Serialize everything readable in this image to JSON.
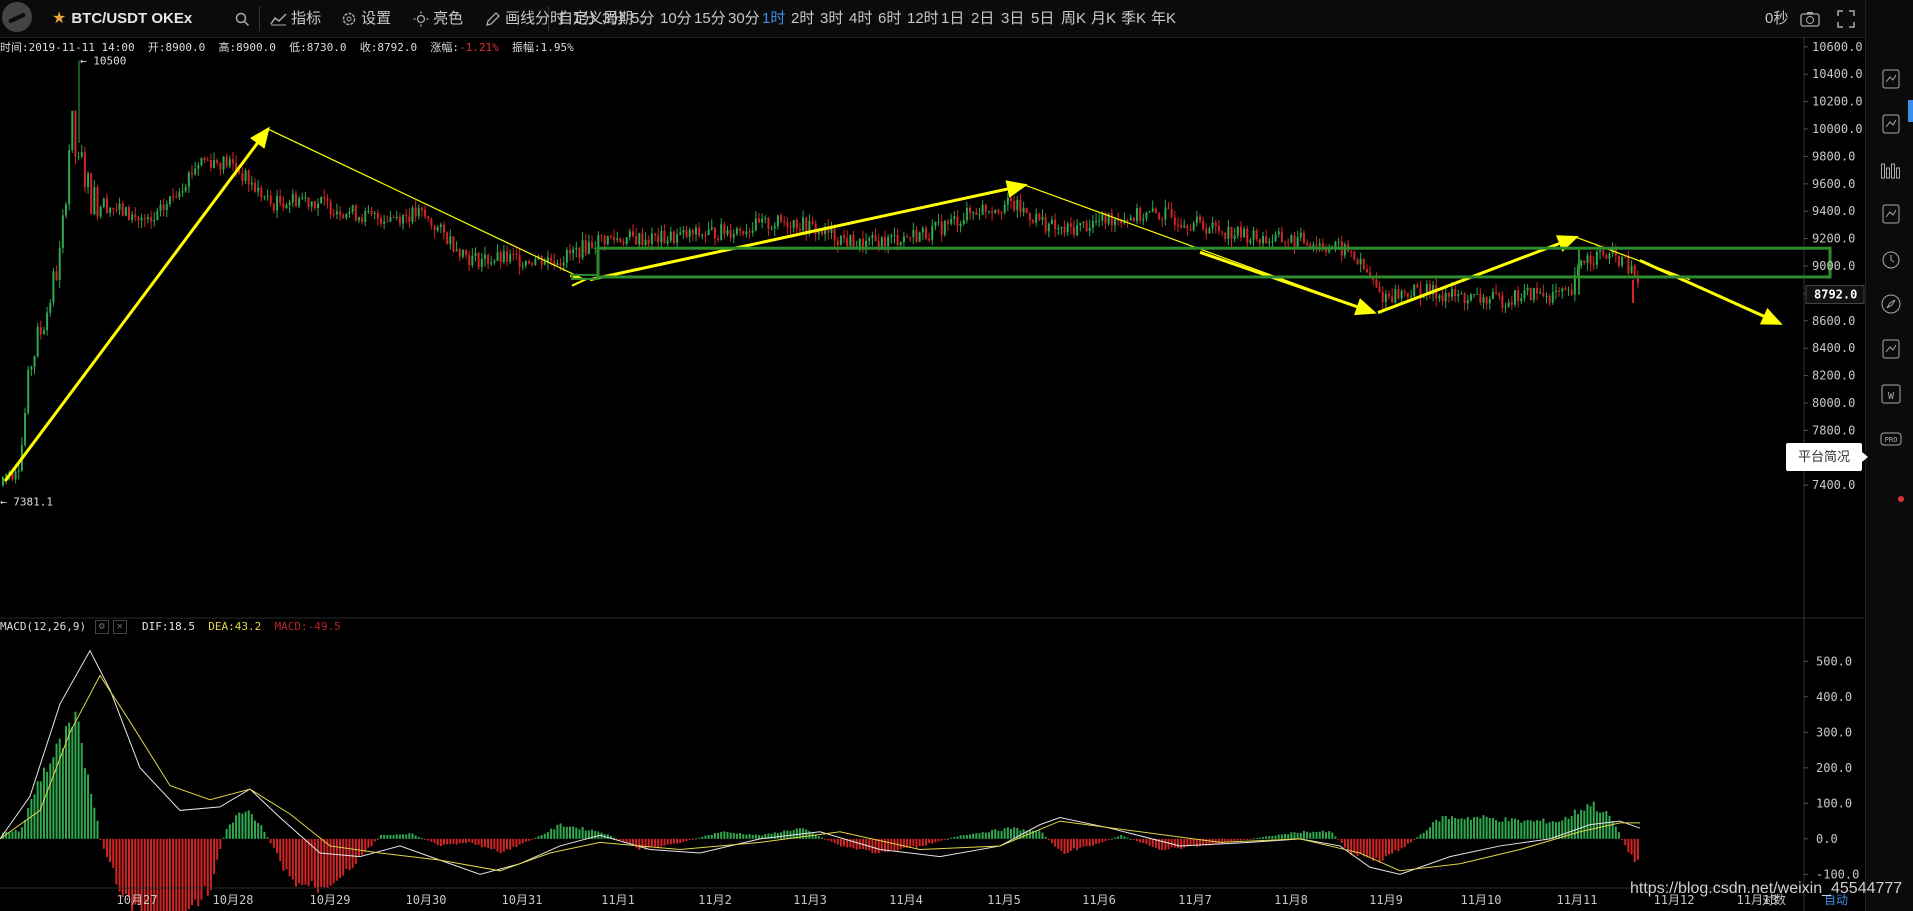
{
  "toolbar": {
    "symbol": "BTC/USDT OKEx",
    "indicators_label": "指标",
    "settings_label": "设置",
    "theme_label": "亮色",
    "draw_label": "画线",
    "custom_period_label": "自定义周期",
    "periods": [
      "分时",
      "1分",
      "3分",
      "5分",
      "10分",
      "15分",
      "30分",
      "1时",
      "2时",
      "3时",
      "4时",
      "6时",
      "12时",
      "1日",
      "2日",
      "3日",
      "5日",
      "周K",
      "月K",
      "季K",
      "年K"
    ],
    "active_period": "1时",
    "seconds_label": "0秒"
  },
  "info": {
    "time_label": "时间:",
    "time": "2019-11-11 14:00",
    "open_label": "开:",
    "open": "8900.0",
    "high_label": "高:",
    "high": "8900.0",
    "low_label": "低:",
    "low": "8730.0",
    "close_label": "收:",
    "close": "8792.0",
    "change_label": "涨幅:",
    "change": "-1.21%",
    "amp_label": "振幅:",
    "amp": "1.95%"
  },
  "macd": {
    "title": "MACD(12,26,9)",
    "dif_label": "DIF:",
    "dif": "18.5",
    "dea_label": "DEA:",
    "dea": "43.2",
    "macd_label": "MACD:",
    "macd": "-49.5"
  },
  "main_axis": {
    "ticks": [
      "10600.0",
      "10400.0",
      "10200.0",
      "10000.0",
      "9800.0",
      "9600.0",
      "9400.0",
      "9200.0",
      "9000.0",
      "8800.0",
      "8600.0",
      "8400.0",
      "8200.0",
      "8000.0",
      "7800.0",
      "7600.0",
      "7400.0"
    ],
    "current_price": "8792.0",
    "max_label": "← 10500",
    "min_label": "← 7381.1"
  },
  "macd_axis": {
    "ticks": [
      "500.0",
      "400.0",
      "300.0",
      "200.0",
      "100.0",
      "0.0",
      "-100.0"
    ]
  },
  "time_axis": {
    "labels": [
      "10月27",
      "10月28",
      "10月29",
      "10月30",
      "10月31",
      "11月1",
      "11月2",
      "11月3",
      "11月4",
      "11月5",
      "11月6",
      "11月7",
      "11月8",
      "11月9",
      "11月10",
      "11月11",
      "11月12",
      "11月13",
      "对数",
      "自动"
    ]
  },
  "tooltip": "平台简况",
  "watermark": "https://blog.csdn.net/weixin_45544777",
  "colors": {
    "up": "#2fa84f",
    "down": "#d22525",
    "annotation": "#ffff00",
    "box": "#2e8b2e",
    "dif": "#e6e6e6",
    "dea": "#e1d548",
    "active": "#3d8eea"
  },
  "right_icons": [
    "chart-line-icon",
    "document-settings-icon",
    "bar-chart-icon",
    "add-page-icon",
    "alarm-clock-icon",
    "compass-icon",
    "notes-icon",
    "w-icon",
    "pro-icon"
  ],
  "chart_data": {
    "type": "candlestick",
    "x": [
      "10月27",
      "10月28",
      "10月29",
      "10月30",
      "10月31",
      "11月1",
      "11月2",
      "11月3",
      "11月4",
      "11月5",
      "11月6",
      "11月7",
      "11月8",
      "11月9",
      "11月10",
      "11月11"
    ],
    "close": [
      9500,
      9700,
      9400,
      9300,
      9050,
      9150,
      9200,
      9300,
      9200,
      9400,
      9350,
      9200,
      9150,
      8800,
      8750,
      8792
    ],
    "last": {
      "time": "2019-11-11 14:00",
      "open": 8900.0,
      "high": 8900.0,
      "low": 8730.0,
      "close": 8792.0
    },
    "price_high": 10500,
    "price_low": 7381.1,
    "ylim": [
      7350,
      10650
    ],
    "macd_ylim": [
      -130,
      560
    ]
  }
}
